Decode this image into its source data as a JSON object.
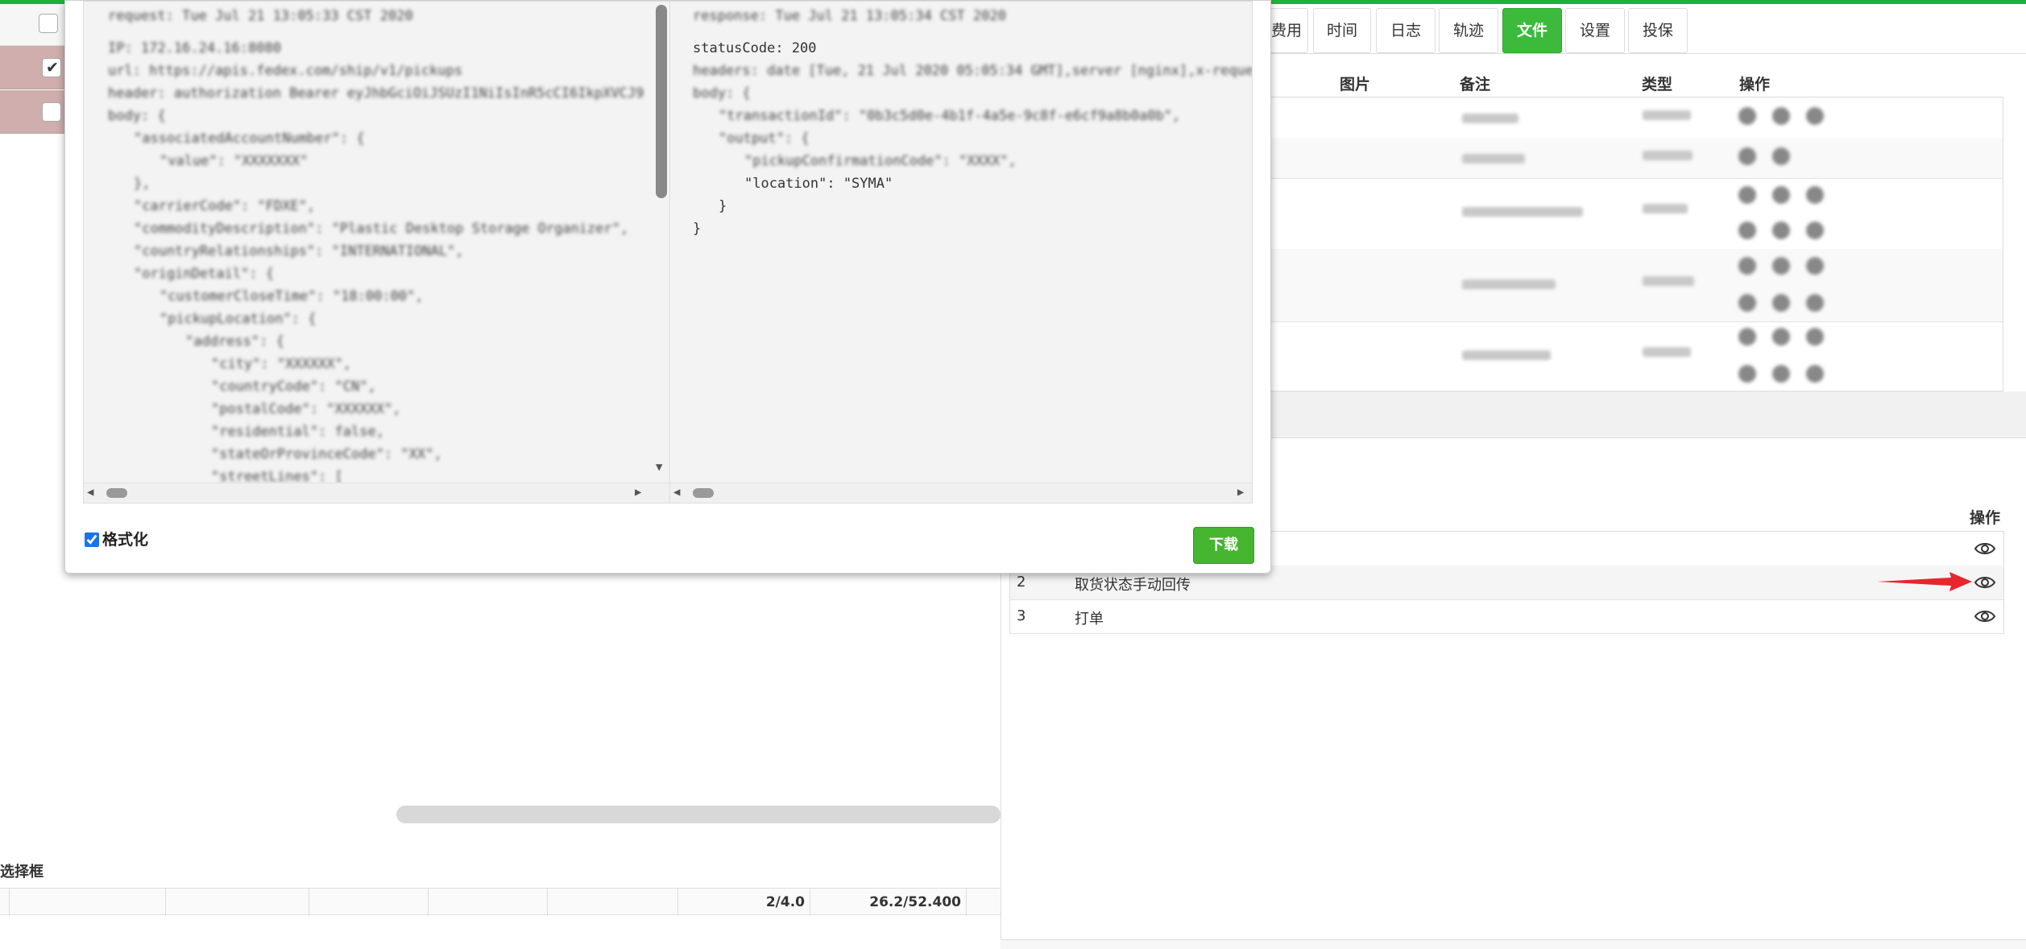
{
  "tabs": [
    {
      "label": "费用"
    },
    {
      "label": "时间"
    },
    {
      "label": "日志"
    },
    {
      "label": "轨迹"
    },
    {
      "label": "文件",
      "active": true
    },
    {
      "label": "设置"
    },
    {
      "label": "投保"
    }
  ],
  "file_table": {
    "headers": {
      "image": "图片",
      "remark": "备注",
      "type": "类型",
      "actions": "操作"
    }
  },
  "log_table": {
    "actions_header": "操作",
    "rows": [
      {
        "num": "",
        "name": ""
      },
      {
        "num": "2",
        "name": "取货状态手动回传"
      },
      {
        "num": "3",
        "name": "打单"
      }
    ]
  },
  "left": {
    "selector_label": "选择框",
    "col_a": "2/4.0",
    "col_b": "26.2/52.400"
  },
  "modal": {
    "response_lines": {
      "status": "statusCode: 200",
      "location": "\"location\": \"SYMA\"",
      "close_inner": "}",
      "close_outer": "}"
    },
    "format_label": "格式化",
    "format_checked": true,
    "download_label": "下载"
  },
  "colors": {
    "accent": "#3bba3b",
    "download": "#46b530",
    "arrow": "#e8262b",
    "topbar": "#1db13a"
  }
}
